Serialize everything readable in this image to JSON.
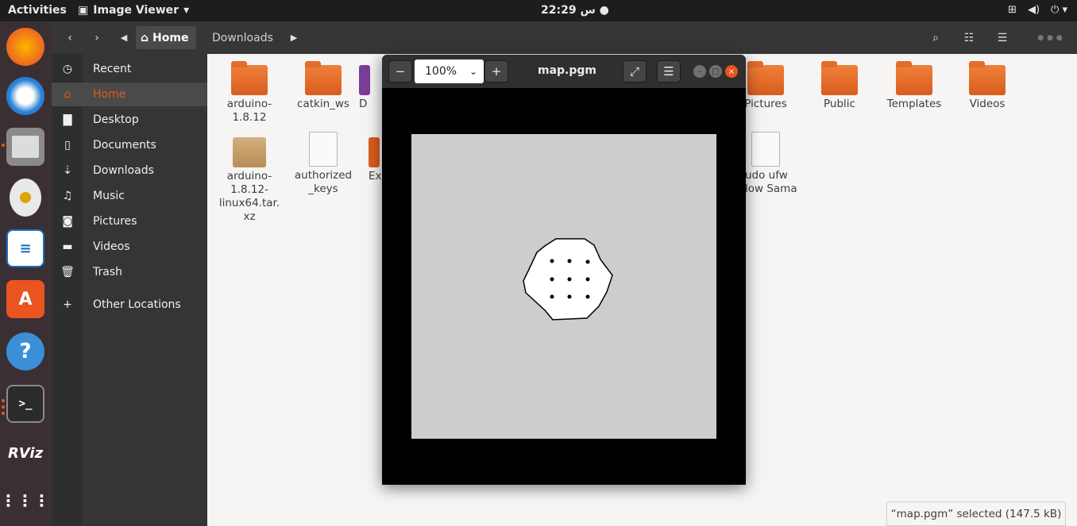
{
  "topbar": {
    "activities": "Activities",
    "app_name": "Image Viewer",
    "clock": "22:29 س",
    "tray_icons": [
      "network-icon",
      "volume-icon",
      "power-icon"
    ]
  },
  "dock": {
    "apps": [
      "firefox-icon",
      "thunderbird-icon",
      "files-icon",
      "rhythmbox-icon",
      "writer-icon",
      "software-icon",
      "help-icon",
      "terminal-icon",
      "rviz-icon",
      "show-apps-icon"
    ],
    "rviz_label": "RViz"
  },
  "files": {
    "breadcrumb": {
      "home": "Home",
      "downloads": "Downloads"
    },
    "sidebar": [
      {
        "label": "Recent",
        "icon": "clock-icon"
      },
      {
        "label": "Home",
        "icon": "home-icon"
      },
      {
        "label": "Desktop",
        "icon": "folder-icon"
      },
      {
        "label": "Documents",
        "icon": "document-icon"
      },
      {
        "label": "Downloads",
        "icon": "download-icon"
      },
      {
        "label": "Music",
        "icon": "music-icon"
      },
      {
        "label": "Pictures",
        "icon": "camera-icon"
      },
      {
        "label": "Videos",
        "icon": "video-icon"
      },
      {
        "label": "Trash",
        "icon": "trash-icon"
      },
      {
        "label": "Other Locations",
        "icon": "plus-icon"
      }
    ],
    "items": [
      {
        "name": "arduino-\n1.8.12",
        "kind": "folder"
      },
      {
        "name": "catkin_ws",
        "kind": "folder"
      },
      {
        "name": "D",
        "kind": "folder-partial"
      },
      {
        "name": "Pictures",
        "kind": "folder"
      },
      {
        "name": "Public",
        "kind": "folder"
      },
      {
        "name": "Templates",
        "kind": "folder"
      },
      {
        "name": "Videos",
        "kind": "folder"
      },
      {
        "name": "arduino-\n1.8.12-\nlinux64.tar.\nxz",
        "kind": "archive"
      },
      {
        "name": "authorized\n_keys",
        "kind": "document"
      },
      {
        "name": "Ex",
        "kind": "folder-partial"
      },
      {
        "name": "udo ufw\nlow Sama",
        "kind": "binary"
      }
    ],
    "status": "“map.pgm” selected  (147.5 kB)"
  },
  "viewer": {
    "zoom": "100%",
    "title": "map.pgm"
  }
}
